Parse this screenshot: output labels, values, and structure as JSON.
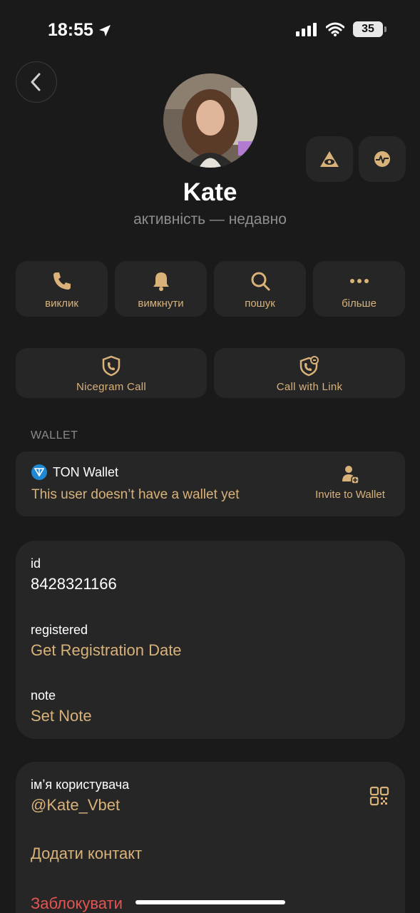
{
  "status_bar": {
    "time": "18:55",
    "battery": "35"
  },
  "profile": {
    "name": "Kate",
    "status": "активність — недавно"
  },
  "actions": [
    {
      "label": "виклик",
      "icon": "phone-icon"
    },
    {
      "label": "вимкнути",
      "icon": "bell-icon"
    },
    {
      "label": "пошук",
      "icon": "search-icon"
    },
    {
      "label": "більше",
      "icon": "more-icon"
    }
  ],
  "call_buttons": [
    {
      "label": "Nicegram Call",
      "icon": "shield-phone-icon"
    },
    {
      "label": "Call with Link",
      "icon": "link-phone-icon"
    }
  ],
  "wallet": {
    "header": "WALLET",
    "title": "TON Wallet",
    "subtitle": "This user doesn’t have a wallet yet",
    "invite_label": "Invite to Wallet"
  },
  "info": {
    "id_key": "id",
    "id_value": "8428321166",
    "registered_key": "registered",
    "registered_value": "Get Registration Date",
    "note_key": "note",
    "note_value": "Set Note"
  },
  "user": {
    "username_key": "імʼя користувача",
    "username_value": "@Kate_Vbet",
    "add_contact": "Додати контакт",
    "block": "Заблокувати"
  },
  "colors": {
    "accent": "#d9b27a",
    "danger": "#e55454",
    "background": "#1a1a1a",
    "card": "#262626"
  }
}
